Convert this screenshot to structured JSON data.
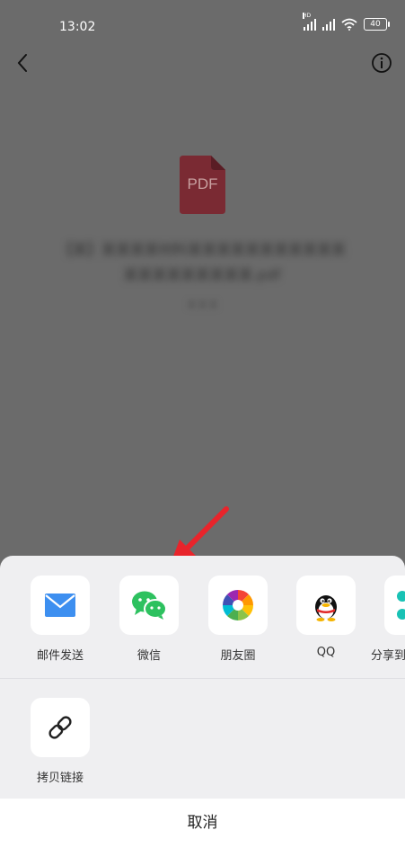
{
  "status_bar": {
    "time": "13:02",
    "hd": "HD",
    "battery": "40"
  },
  "file": {
    "type_label": "PDF",
    "name": "【某】某某某某材料某某某某某某某某某某某某某某某某某某某某.pdf",
    "size": "某某某"
  },
  "share_options": [
    {
      "label": "邮件发送",
      "icon": "mail-icon"
    },
    {
      "label": "微信",
      "icon": "wechat-icon"
    },
    {
      "label": "朋友圈",
      "icon": "moments-icon"
    },
    {
      "label": "QQ",
      "icon": "qq-icon"
    },
    {
      "label": "分享到",
      "icon": "share-to-icon"
    }
  ],
  "more_options": [
    {
      "label": "拷贝链接",
      "icon": "link-icon"
    }
  ],
  "cancel_label": "取消",
  "colors": {
    "overlay": "#6b6b6b",
    "sheet": "#efeff1",
    "pdf_icon": "#7a2a33",
    "wechat": "#2dc15f",
    "mail": "#3d8ff0",
    "arrow": "#e8242b"
  }
}
